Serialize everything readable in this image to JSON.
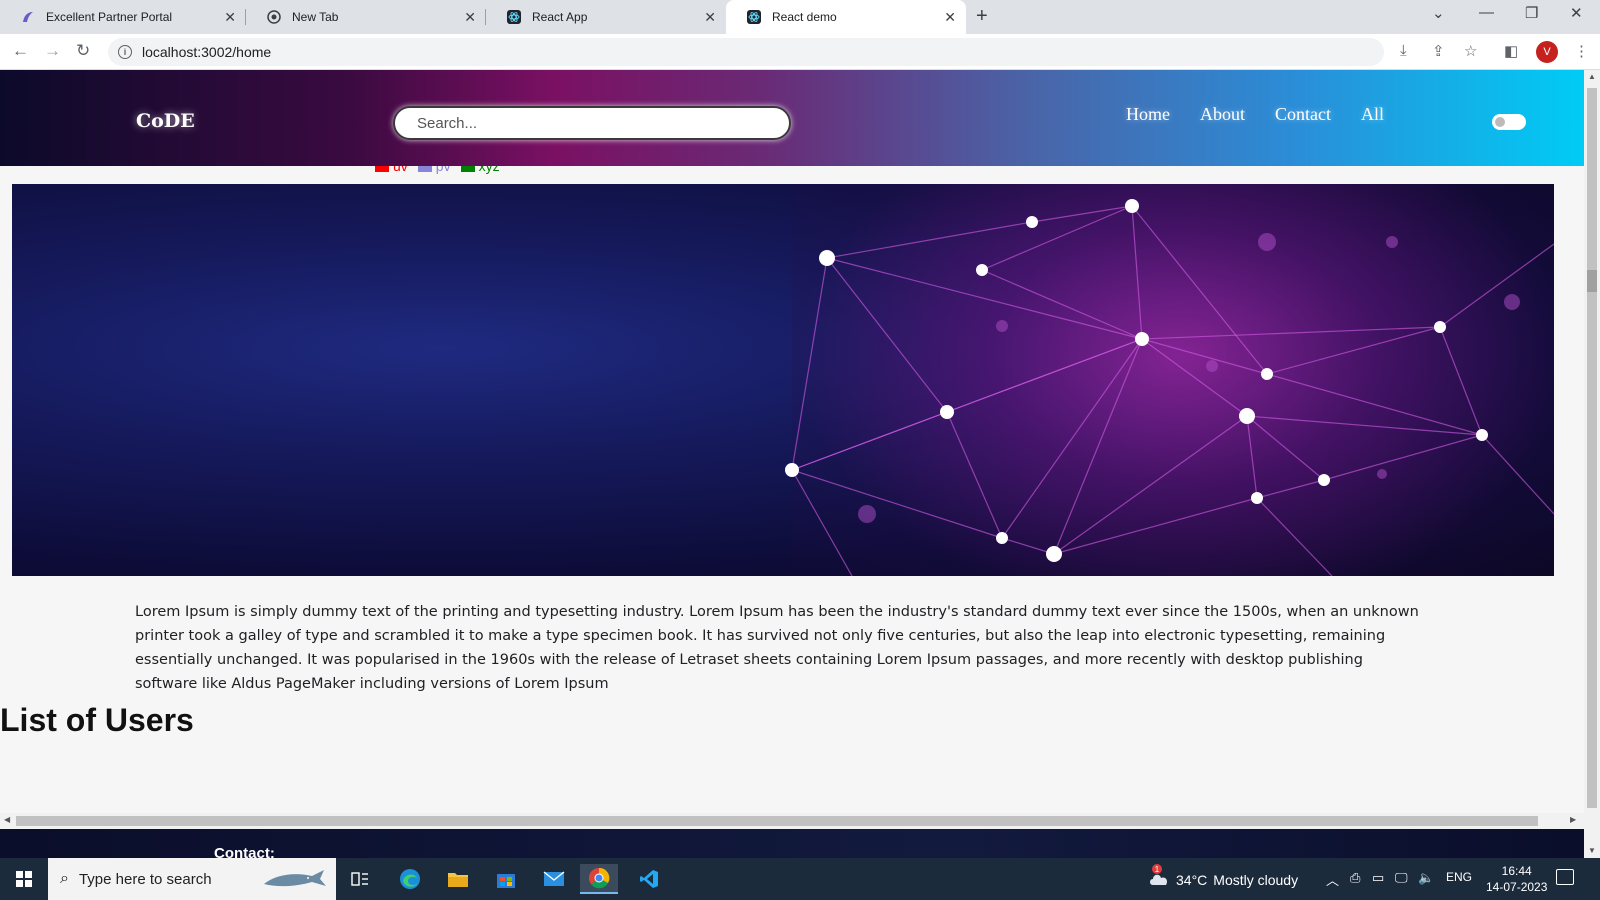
{
  "browser": {
    "tabs": [
      {
        "title": "Excellent Partner Portal",
        "icon": "portal-favicon-icon"
      },
      {
        "title": "New Tab",
        "icon": "chrome-favicon-icon"
      },
      {
        "title": "React App",
        "icon": "react-favicon-icon"
      },
      {
        "title": "React demo",
        "icon": "react-favicon-icon",
        "active": true
      }
    ],
    "url": "localhost:3002/home",
    "profile_initial": "V"
  },
  "site": {
    "logo": "CoDE",
    "search_placeholder": "Search...",
    "nav": [
      {
        "label": "Home"
      },
      {
        "label": "About"
      },
      {
        "label": "Contact"
      },
      {
        "label": "All"
      }
    ],
    "theme_toggle_on": false
  },
  "legend": {
    "items": [
      {
        "label": "uv",
        "color": "#ff0000"
      },
      {
        "label": "pv",
        "color": "#8884d8"
      },
      {
        "label": "xyz",
        "color": "#008000"
      }
    ]
  },
  "content": {
    "paragraph": "Lorem Ipsum is simply dummy text of the printing and typesetting industry. Lorem Ipsum has been the industry's standard dummy text ever since the 1500s, when an unknown printer took a galley of type and scrambled it to make a type specimen book. It has survived not only five centuries, but also the leap into electronic typesetting, remaining essentially unchanged. It was popularised in the 1960s with the release of Letraset sheets containing Lorem Ipsum passages, and more recently with desktop publishing software like Aldus PageMaker including versions of Lorem Ipsum",
    "users_heading": "List of Users"
  },
  "footer": {
    "contact_label": "Contact:"
  },
  "taskbar": {
    "search_placeholder": "Type here to search",
    "weather_temp": "34°C",
    "weather_desc": "Mostly cloudy",
    "weather_badge": "1",
    "language": "ENG",
    "time": "16:44",
    "date": "14-07-2023"
  },
  "colors": {
    "header_gradient_start": "#0c0a2a",
    "header_gradient_mid": "#7b1063",
    "header_gradient_end": "#00ccf5",
    "hero_base": "#15195a",
    "hero_glow": "#aa28aa"
  }
}
